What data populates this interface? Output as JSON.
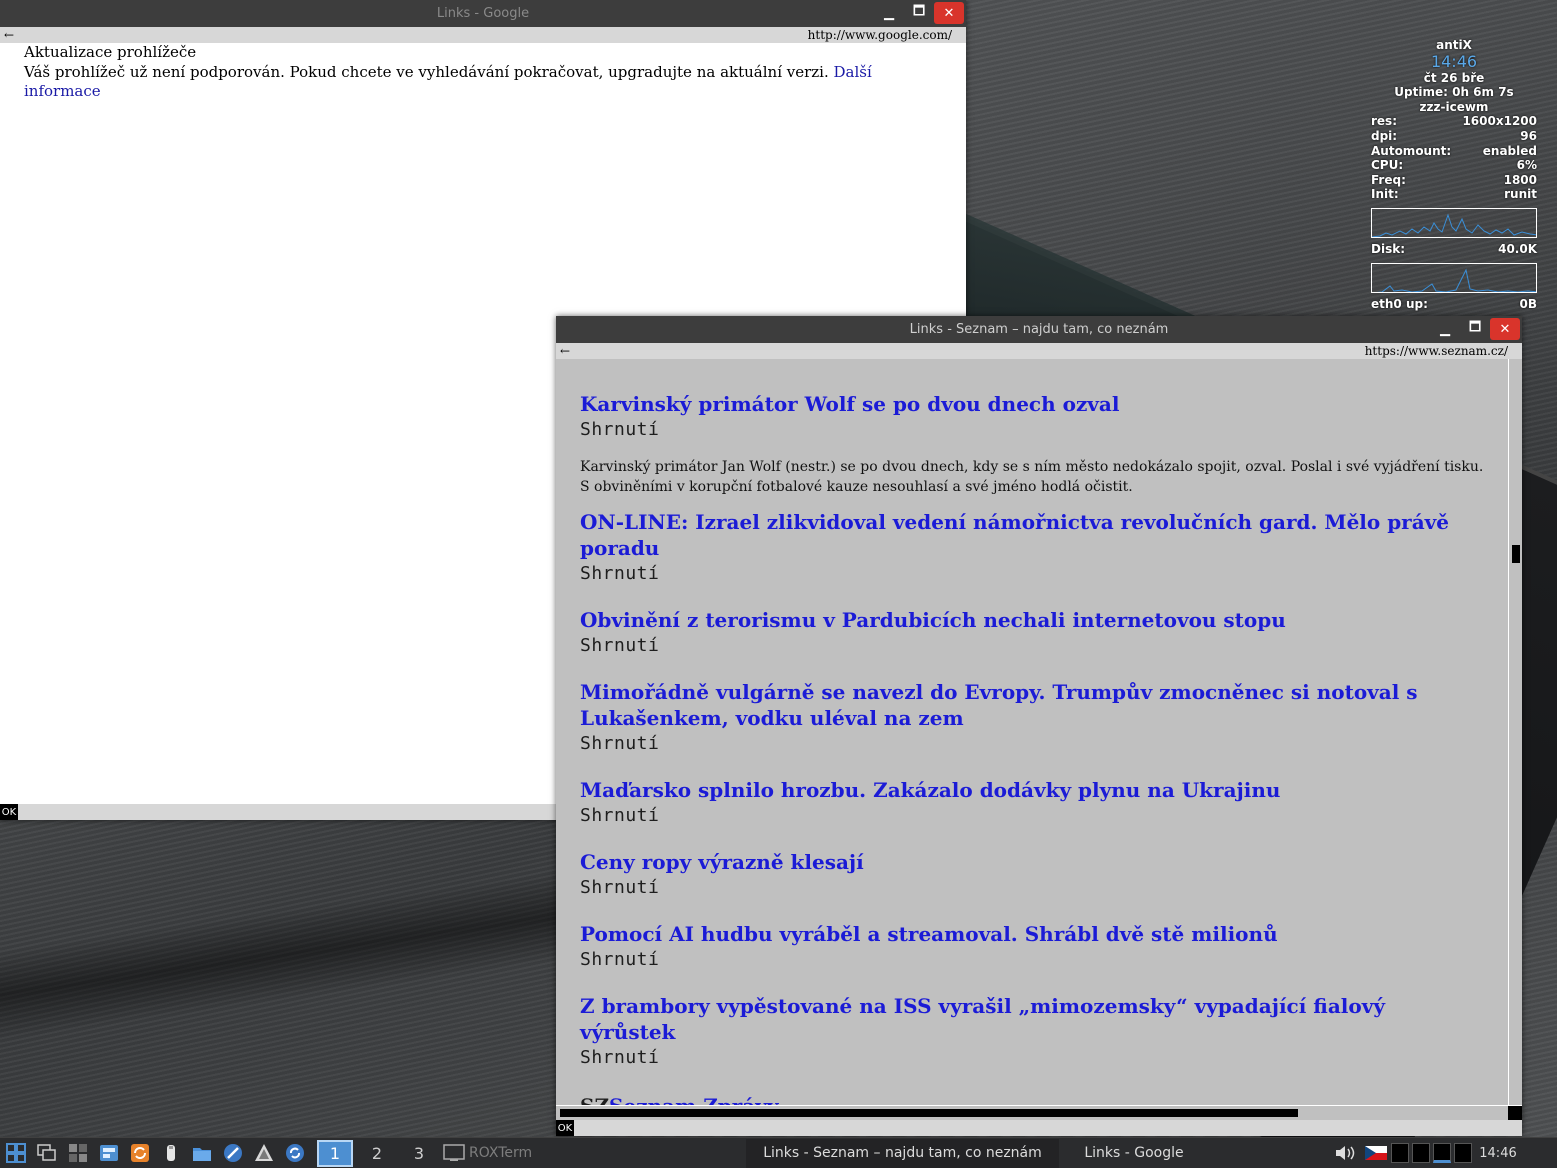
{
  "conky": {
    "host": "antiX",
    "time": "14:46",
    "date": "čt 26 bře",
    "uptime": "Uptime: 0h 6m 7s",
    "wm": "zzz-icewm",
    "rows": [
      {
        "label": "res:",
        "value": "1600x1200"
      },
      {
        "label": "dpi:",
        "value": "96"
      },
      {
        "label": "Automount:",
        "value": "enabled"
      },
      {
        "label": "CPU:",
        "value": "6%"
      },
      {
        "label": "Freq:",
        "value": "1800"
      },
      {
        "label": "Init:",
        "value": "runit"
      }
    ],
    "disk_label": "Disk:",
    "disk_value": "40.0K",
    "eth_label": "eth0 up:",
    "eth_value": "0B",
    "graph_color": "#3a8fd8"
  },
  "google_window": {
    "title": "Links - Google",
    "back_arrow": "←",
    "url": "http://www.google.com/",
    "heading": "Aktualizace prohlížeče",
    "message": "Váš prohlížeč už není podporován. Pokud chcete ve vyhledávání pokračovat, upgradujte na aktuální verzi.",
    "link_text_1": "Další",
    "link_text_2": "informace",
    "status": "OK"
  },
  "seznam_window": {
    "title": "Links - Seznam – najdu tam, co neznám",
    "back_arrow": "←",
    "url": "https://www.seznam.cz/",
    "status": "OK",
    "summary_label": "Shrnutí",
    "articles": [
      {
        "headline": "Karvinský primátor Wolf se po dvou dnech ozval",
        "summary": "Karvinský primátor Jan Wolf (nestr.) se po dvou dnech, kdy se s ním město nedokázalo spojit, ozval. Poslal i své vyjádření tisku. S obviněními v korupční fotbalové kauze nesouhlasí a své jméno hodlá očistit."
      },
      {
        "headline": "ON-LINE: Izrael zlikvidoval vedení námořnictva revolučních gard. Mělo právě poradu"
      },
      {
        "headline": "Obvinění z terorismu v Pardubicích nechali internetovou stopu"
      },
      {
        "headline": "Mimořádně vulgárně se navezl do Evropy. Trumpův zmocněnec si notoval s Lukašenkem, vodku uléval na zem"
      },
      {
        "headline": "Maďarsko splnilo hrozbu. Zakázalo dodávky plynu na Ukrajinu"
      },
      {
        "headline": "Ceny ropy výrazně klesají"
      },
      {
        "headline": "Pomocí AI hudbu vyráběl a streamoval. Shrábl dvě stě milionů"
      },
      {
        "headline": "Z brambory vypěstované na ISS vyrašil „mimozemsky“ vypadající fialový výrůstek"
      }
    ],
    "footer_prefix": "SZ",
    "footer_link": "Seznam Zprávy"
  },
  "taskbar": {
    "workspaces": [
      "1",
      "2",
      "3"
    ],
    "roxterm": "ROXTerm",
    "tasks": [
      "Links - Seznam – najdu tam, co neznám",
      "Links - Google"
    ],
    "clock": "14:46"
  }
}
